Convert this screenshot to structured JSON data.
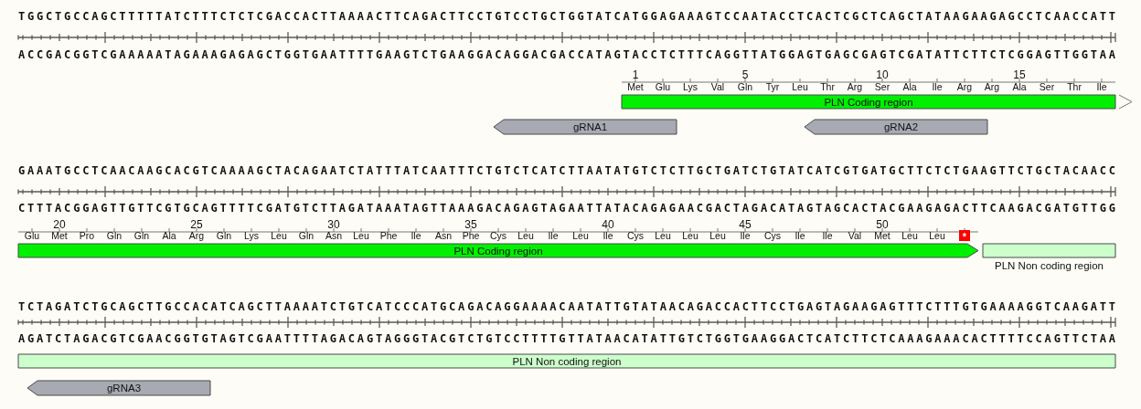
{
  "map_blocks": [
    {
      "top_strand": "TGGCTGCCAGCTTTTTATCTTTCTCTCGACCACTTAAAACTTCAGACTTCCTGTCCTGCTGGTATCATGGAGAAAGTCCAATACCTCACTCGCTCAGCTATAAGAAGAGCCTCAACCATT",
      "bottom_strand": "ACCGACGGTCGAAAAATAGAAAGAGAGCTGGTGAATTTTGAAGTCTGAAGGACAGGACGACCATAGTACCTCTTTCAGGTTATGGAGTGAGCGAGTCGATATTCTTCTCGGAGTTGGTAA",
      "translation": [
        {
          "kind": "amino",
          "aa": "Met",
          "number": "1"
        },
        {
          "kind": "amino",
          "aa": "Glu"
        },
        {
          "kind": "amino",
          "aa": "Lys"
        },
        {
          "kind": "amino",
          "aa": "Val"
        },
        {
          "kind": "amino",
          "aa": "Gln",
          "number": "5"
        },
        {
          "kind": "amino",
          "aa": "Tyr"
        },
        {
          "kind": "amino",
          "aa": "Leu"
        },
        {
          "kind": "amino",
          "aa": "Thr"
        },
        {
          "kind": "amino",
          "aa": "Arg"
        },
        {
          "kind": "amino",
          "aa": "Ser",
          "number": "10"
        },
        {
          "kind": "amino",
          "aa": "Ala"
        },
        {
          "kind": "amino",
          "aa": "Ile"
        },
        {
          "kind": "amino",
          "aa": "Arg"
        },
        {
          "kind": "amino",
          "aa": "Arg"
        },
        {
          "kind": "amino",
          "aa": "Ala",
          "number": "15"
        },
        {
          "kind": "amino",
          "aa": "Ser"
        },
        {
          "kind": "amino",
          "aa": "Thr"
        },
        {
          "kind": "amino",
          "aa": "Ile"
        }
      ],
      "features": [
        {
          "kind": "cds",
          "label": "PLN Coding region",
          "continues": true
        },
        {
          "kind": "grna",
          "label": "gRNA1"
        },
        {
          "kind": "grna",
          "label": "gRNA2"
        }
      ]
    },
    {
      "top_strand": "GAAATGCCTCAACAAGCACGTCAAAAGCTACAGAATCTATTTATCAATTTCTGTCTCATCTTAATATGTCTCTTGCTGATCTGTATCATCGTGATGCTTCTCTGAAGTTCTGCTACAACC",
      "bottom_strand": "CTTTACGGAGTTGTTCGTGCAGTTTTCGATGTCTTAGATAAATAGTTAAAGACAGAGTAGAATTATACAGAGAACGACTAGACATAGTAGCACTACGAAGAGACTTCAAGACGATGTTGG",
      "translation": [
        {
          "kind": "amino",
          "aa": "Glu"
        },
        {
          "kind": "amino",
          "aa": "Met",
          "number": "20"
        },
        {
          "kind": "amino",
          "aa": "Pro"
        },
        {
          "kind": "amino",
          "aa": "Gln"
        },
        {
          "kind": "amino",
          "aa": "Gln"
        },
        {
          "kind": "amino",
          "aa": "Ala"
        },
        {
          "kind": "amino",
          "aa": "Arg",
          "number": "25"
        },
        {
          "kind": "amino",
          "aa": "Gln"
        },
        {
          "kind": "amino",
          "aa": "Lys"
        },
        {
          "kind": "amino",
          "aa": "Leu"
        },
        {
          "kind": "amino",
          "aa": "Gln"
        },
        {
          "kind": "amino",
          "aa": "Asn",
          "number": "30"
        },
        {
          "kind": "amino",
          "aa": "Leu"
        },
        {
          "kind": "amino",
          "aa": "Phe"
        },
        {
          "kind": "amino",
          "aa": "Ile"
        },
        {
          "kind": "amino",
          "aa": "Asn"
        },
        {
          "kind": "amino",
          "aa": "Phe",
          "number": "35"
        },
        {
          "kind": "amino",
          "aa": "Cys"
        },
        {
          "kind": "amino",
          "aa": "Leu"
        },
        {
          "kind": "amino",
          "aa": "Ile"
        },
        {
          "kind": "amino",
          "aa": "Leu"
        },
        {
          "kind": "amino",
          "aa": "Ile",
          "number": "40"
        },
        {
          "kind": "amino",
          "aa": "Cys"
        },
        {
          "kind": "amino",
          "aa": "Leu"
        },
        {
          "kind": "amino",
          "aa": "Leu"
        },
        {
          "kind": "amino",
          "aa": "Leu"
        },
        {
          "kind": "amino",
          "aa": "Ile",
          "number": "45"
        },
        {
          "kind": "amino",
          "aa": "Cys"
        },
        {
          "kind": "amino",
          "aa": "Ile"
        },
        {
          "kind": "amino",
          "aa": "Ile"
        },
        {
          "kind": "amino",
          "aa": "Val"
        },
        {
          "kind": "amino",
          "aa": "Met",
          "number": "50"
        },
        {
          "kind": "amino",
          "aa": "Leu"
        },
        {
          "kind": "amino",
          "aa": "Leu"
        },
        {
          "kind": "stop",
          "aa": "*"
        }
      ],
      "features": [
        {
          "kind": "cds",
          "label": "PLN Coding region",
          "continues": false
        },
        {
          "kind": "noncoding",
          "label": "PLN Non coding region"
        }
      ]
    },
    {
      "top_strand": "TCTAGATCTGCAGCTTGCCACATCAGCTTAAAATCTGTCATCCCATGCAGACAGGAAAACAATATTGTATAACAGACCACTTCCTGAGTAGAAGAGTTTCTTTGTGAAAAGGTCAAGATT",
      "bottom_strand": "AGATCTAGACGTCGAACGGTGTAGTCGAATTTTAGACAGTAGGGTACGTCTGTCCTTTTGTTATAACATATTGTCTGGTGAAGGACTCATCTTCTCAAAGAAACACTTTTCCAGTTCTAA",
      "features": [
        {
          "kind": "noncoding",
          "label": "PLN Non coding region"
        },
        {
          "kind": "grna",
          "label": "gRNA3"
        }
      ]
    }
  ]
}
